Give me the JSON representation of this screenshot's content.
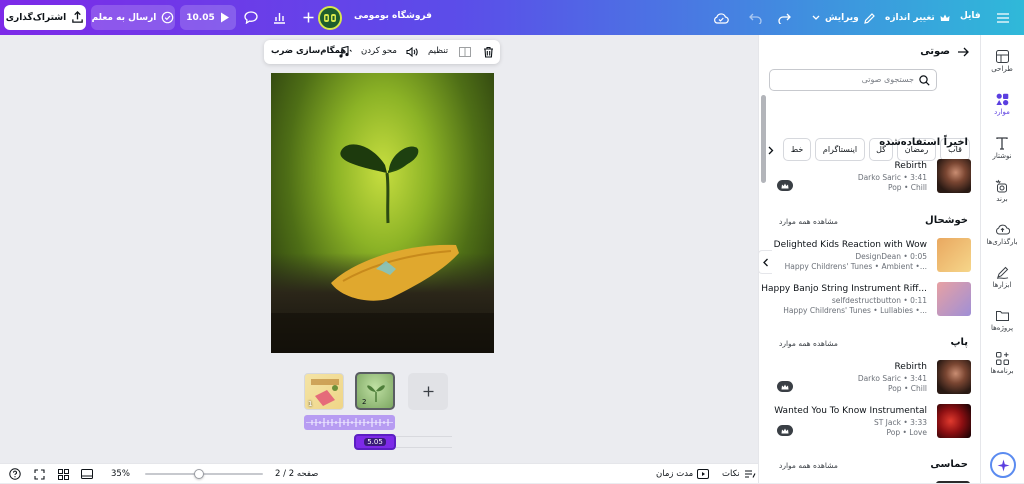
{
  "topbar": {
    "file_label": "فایل",
    "resize_label": "تغییر اندازه",
    "edit_label": "ویرایش",
    "store_name": "فروشگاه بومومی",
    "timer": "10.05",
    "send_label": "ارسال به معلم",
    "share_label": "اشتراک‌گذاری"
  },
  "toolbar": {
    "sync_label": "همگام‌سازی ضرب",
    "fade_label": "محو کردن",
    "adjust_label": "تنظیم"
  },
  "rail": {
    "items": [
      {
        "label": "طراحی",
        "icon": "layout-icon"
      },
      {
        "label": "موارد",
        "icon": "elements-icon"
      },
      {
        "label": "نوشتار",
        "icon": "text-icon"
      },
      {
        "label": "برند",
        "icon": "brand-icon"
      },
      {
        "label": "بارگذاری‌ها",
        "icon": "upload-cloud-icon"
      },
      {
        "label": "ابزارها",
        "icon": "draw-icon"
      },
      {
        "label": "پروژه‌ها",
        "icon": "folder-icon"
      },
      {
        "label": "برنامه‌ها",
        "icon": "apps-icon"
      }
    ]
  },
  "panel": {
    "title": "صوتی",
    "search_placeholder": "جستجوی صوتی",
    "chips": [
      "قاب",
      "رمضان",
      "گل",
      "اینستاگرام",
      "خط"
    ],
    "recent_title": "اخیراً استفاده‌شده",
    "see_all": "مشاهده همه موارد",
    "sections": [
      {
        "title": "خوشحال"
      },
      {
        "title": "پاپ"
      },
      {
        "title": "حماسی"
      }
    ],
    "tracks": {
      "recent": {
        "title": "Rebirth",
        "artist": "Darko Saric • 3:41",
        "tags": "Pop • Chill"
      },
      "happy1": {
        "title": "Delighted Kids Reaction with Wow",
        "artist": "DesignDean • 0:05",
        "tags": "Happy Childrens' Tunes • Ambient •..."
      },
      "happy2": {
        "title": "Happy Banjo String Instrument Riff...",
        "artist": "selfdestructbutton • 0:11",
        "tags": "Happy Childrens' Tunes • Lullabies •..."
      },
      "pop1": {
        "title": "Rebirth",
        "artist": "Darko Saric • 3:41",
        "tags": "Pop • Chill"
      },
      "pop2": {
        "title": "Wanted You To Know Instrumental",
        "artist": "ST Jack • 3:33",
        "tags": "Pop • Love"
      }
    }
  },
  "timeline": {
    "page2_number": "1",
    "page1_number": "2",
    "audio_duration": "5.05"
  },
  "bottombar": {
    "notes_label": "نکات",
    "duration_label": "مدت زمان",
    "page_label": "صفحه 2 / 2",
    "zoom": "35%",
    "zoom_level": 0.35
  },
  "colors": {
    "accent": "#7d2ae8",
    "topbar_end": "#2fb9d9"
  }
}
